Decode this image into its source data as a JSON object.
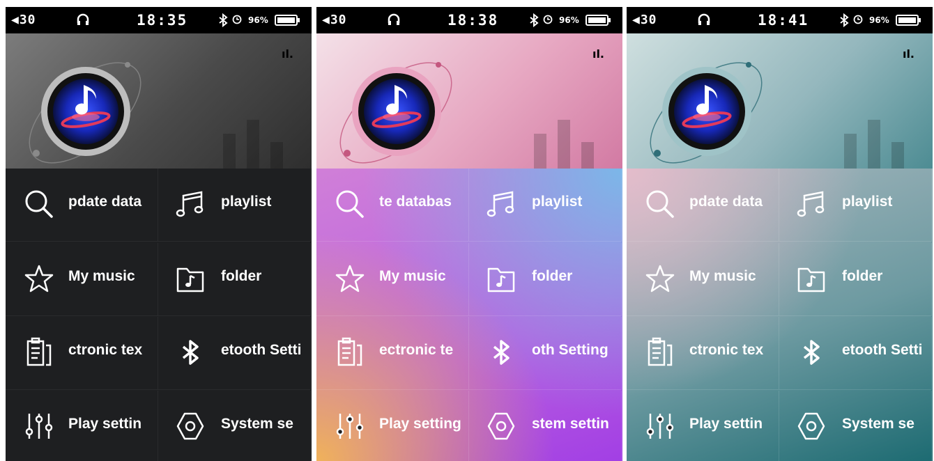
{
  "screens": [
    {
      "theme": "dark",
      "status": {
        "volume": "◀30",
        "time": "18:35",
        "battery": "96%"
      },
      "menu": [
        {
          "label": "pdate data",
          "icon": "search-icon"
        },
        {
          "label": "playlist",
          "icon": "music-note-icon"
        },
        {
          "label": "My music",
          "icon": "star-icon"
        },
        {
          "label": "folder",
          "icon": "folder-music-icon"
        },
        {
          "label": "ctronic tex",
          "icon": "document-icon"
        },
        {
          "label": "etooth Setti",
          "icon": "bluetooth-icon"
        },
        {
          "label": "Play settin",
          "icon": "equalizer-icon"
        },
        {
          "label": "System se",
          "icon": "gear-icon"
        }
      ]
    },
    {
      "theme": "pink",
      "status": {
        "volume": "◀30",
        "time": "18:38",
        "battery": "96%"
      },
      "menu": [
        {
          "label": "te databas",
          "icon": "search-icon"
        },
        {
          "label": "playlist",
          "icon": "music-note-icon"
        },
        {
          "label": "My music",
          "icon": "star-icon"
        },
        {
          "label": "folder",
          "icon": "folder-music-icon"
        },
        {
          "label": "ectronic te",
          "icon": "document-icon"
        },
        {
          "label": "oth Setting",
          "icon": "bluetooth-icon"
        },
        {
          "label": "Play setting",
          "icon": "equalizer-icon"
        },
        {
          "label": "stem settin",
          "icon": "gear-icon"
        }
      ]
    },
    {
      "theme": "teal",
      "status": {
        "volume": "◀30",
        "time": "18:41",
        "battery": "96%"
      },
      "menu": [
        {
          "label": "pdate data",
          "icon": "search-icon"
        },
        {
          "label": "playlist",
          "icon": "music-note-icon"
        },
        {
          "label": "My music",
          "icon": "star-icon"
        },
        {
          "label": "folder",
          "icon": "folder-music-icon"
        },
        {
          "label": "ctronic tex",
          "icon": "document-icon"
        },
        {
          "label": "etooth Setti",
          "icon": "bluetooth-icon"
        },
        {
          "label": "Play settin",
          "icon": "equalizer-icon"
        },
        {
          "label": "System se",
          "icon": "gear-icon"
        }
      ]
    }
  ],
  "signal_glyph": "ıl.",
  "colors": {
    "dark": "#1e1f21",
    "pink_accent": "#c4577f",
    "teal_accent": "#2f6e78"
  }
}
